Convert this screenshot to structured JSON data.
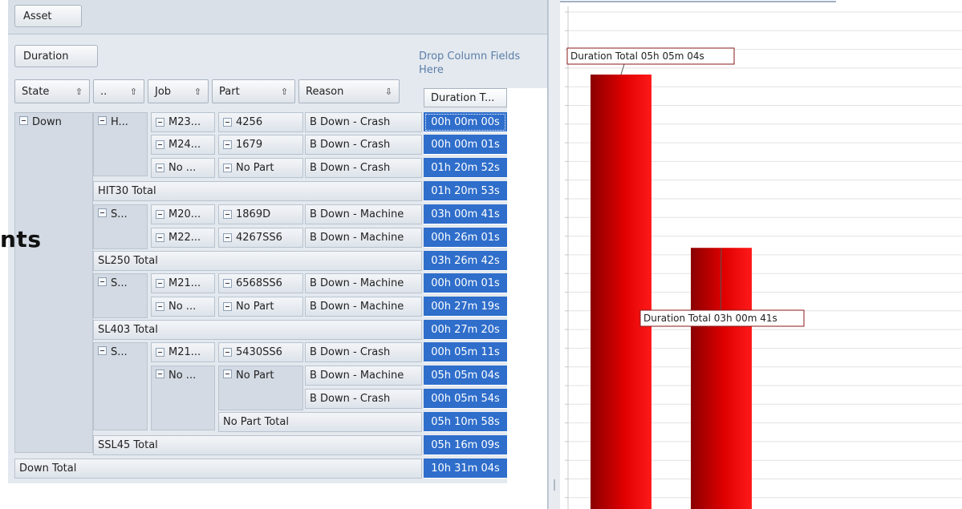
{
  "overlay_text": "nts",
  "pivot": {
    "filter_field": "Asset",
    "data_field": "Duration",
    "drop_hint": "Drop Column Fields Here",
    "row_headers": [
      {
        "label": "State",
        "sort": "⇧"
      },
      {
        "label": "..",
        "sort": "⇧"
      },
      {
        "label": "Job",
        "sort": "⇧"
      },
      {
        "label": "Part",
        "sort": "⇧"
      },
      {
        "label": "Reason",
        "sort": "⇩"
      }
    ],
    "data_header": "Duration T...",
    "state": "Down",
    "assets": [
      "H...",
      "S...",
      "S...",
      "S..."
    ],
    "jobs": [
      "M23...",
      "M24...",
      "No ...",
      "M20...",
      "M22...",
      "M21...",
      "No ...",
      "M21...",
      "No ..."
    ],
    "parts": [
      "4256",
      "1679",
      "No Part",
      "1869D",
      "4267SS6",
      "6568SS6",
      "No Part",
      "5430SS6",
      "No Part"
    ],
    "reasons": [
      "B Down - Crash",
      "B Down - Crash",
      "B Down - Crash",
      "B Down - Machine",
      "B Down - Machine",
      "B Down - Machine",
      "B Down - Machine",
      "B Down - Crash",
      "B Down - Machine",
      "B Down - Crash"
    ],
    "totals": {
      "hit30": "HIT30 Total",
      "sl250": "SL250 Total",
      "sl403": "SL403 Total",
      "nopart": "No Part Total",
      "ssl45": "SSL45 Total",
      "down": "Down Total"
    },
    "values": [
      "00h 00m 00s",
      "00h 00m 01s",
      "01h 20m 52s",
      "01h 20m 53s",
      "03h 00m 41s",
      "00h 26m 01s",
      "03h 26m 42s",
      "00h 00m 01s",
      "00h 27m 19s",
      "00h 27m 20s",
      "00h 05m 11s",
      "05h 05m 04s",
      "00h 05m 54s",
      "05h 10m 58s",
      "05h 16m 09s",
      "10h 31m 04s"
    ]
  },
  "chart_data": {
    "type": "bar",
    "categories": [
      "",
      ""
    ],
    "series": [
      {
        "values": [
          305.07,
          180.68
        ]
      }
    ],
    "annotations": [
      "Duration Total 05h 05m 04s",
      "Duration Total 03h 00m 41s"
    ],
    "ylim": [
      0,
      360
    ],
    "grid": true,
    "bar_color": "#e00000",
    "bar_dark_color": "#8a0000"
  }
}
